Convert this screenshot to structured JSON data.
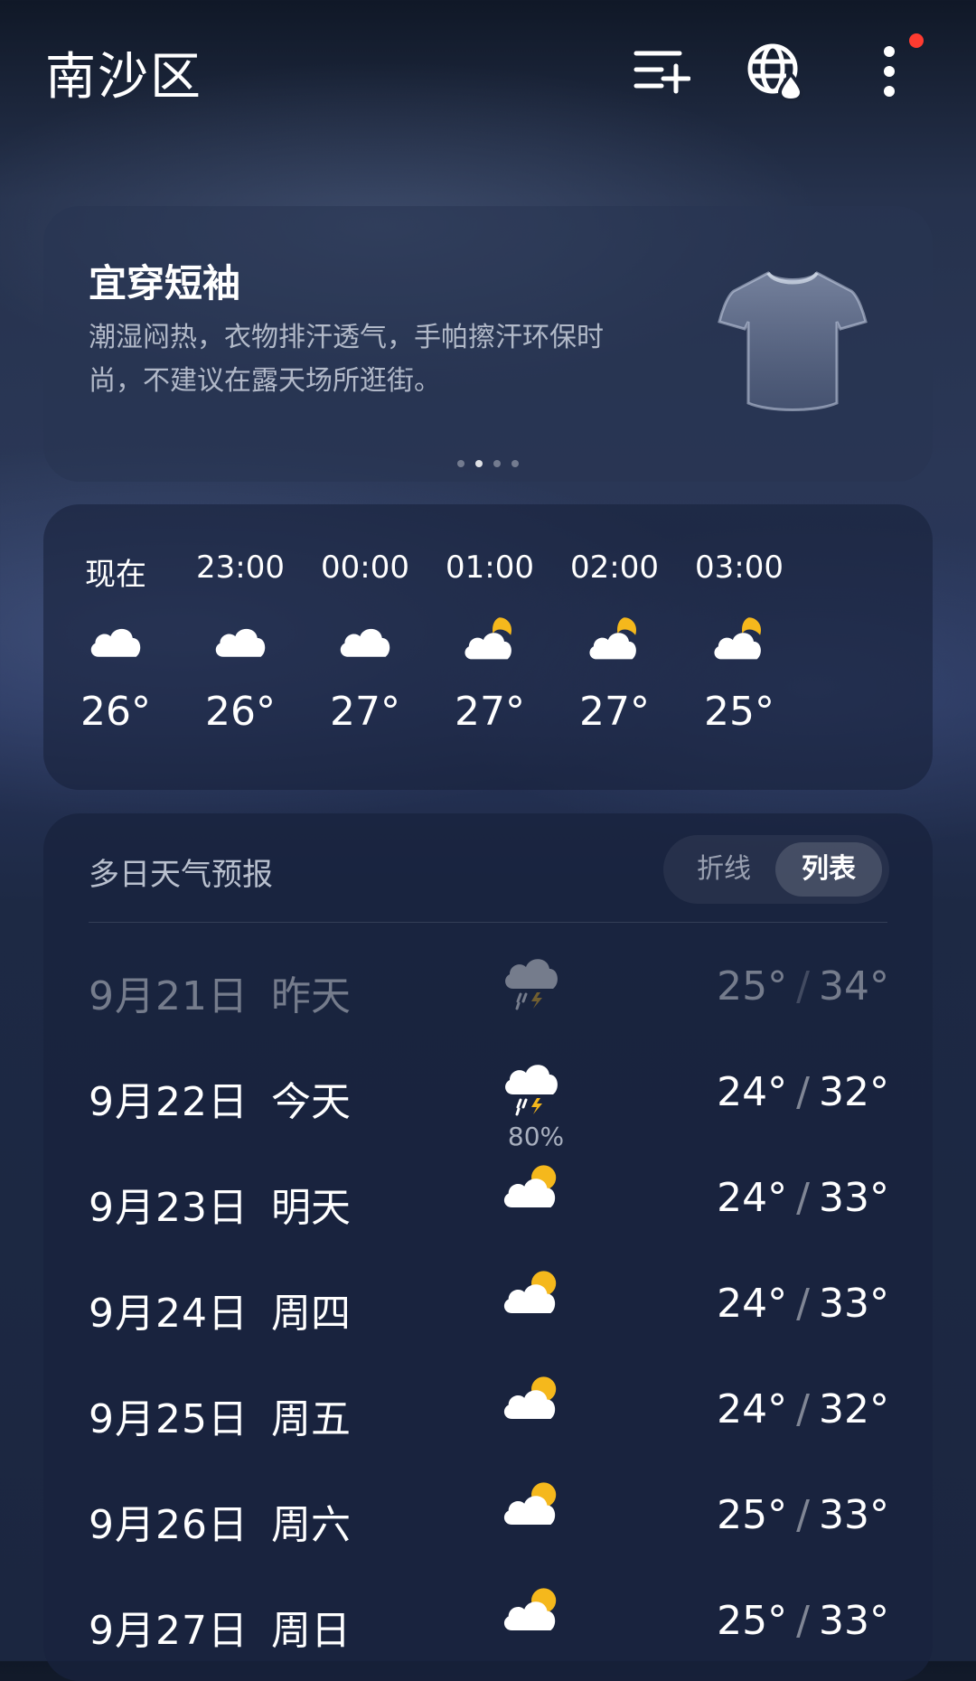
{
  "header": {
    "city": "南沙区"
  },
  "tip": {
    "title": "宜穿短袖",
    "text": "潮湿闷热，衣物排汗透气，手帕擦汗环保时尚，不建议在露天场所逛街。",
    "icon": "tshirt-icon"
  },
  "hourly": [
    {
      "time": "现在",
      "icon": "cloudy-icon",
      "temp": "26°"
    },
    {
      "time": "23:00",
      "icon": "cloudy-icon",
      "temp": "26°"
    },
    {
      "time": "00:00",
      "icon": "cloudy-icon",
      "temp": "27°"
    },
    {
      "time": "01:00",
      "icon": "partly-cloudy-night-icon",
      "temp": "27°"
    },
    {
      "time": "02:00",
      "icon": "partly-cloudy-night-icon",
      "temp": "27°"
    },
    {
      "time": "03:00",
      "icon": "partly-cloudy-night-icon",
      "temp": "25°"
    }
  ],
  "forecast": {
    "title": "多日天气预报",
    "toggle_line": "折线",
    "toggle_list": "列表",
    "days": [
      {
        "date": "9月21日",
        "day": "昨天",
        "icon": "thunderstorm-icon",
        "pop": "",
        "low": "25°",
        "high": "34°"
      },
      {
        "date": "9月22日",
        "day": "今天",
        "icon": "thunderstorm-icon",
        "pop": "80%",
        "low": "24°",
        "high": "32°"
      },
      {
        "date": "9月23日",
        "day": "明天",
        "icon": "partly-cloudy-day-icon",
        "pop": "",
        "low": "24°",
        "high": "33°"
      },
      {
        "date": "9月24日",
        "day": "周四",
        "icon": "partly-cloudy-day-icon",
        "pop": "",
        "low": "24°",
        "high": "33°"
      },
      {
        "date": "9月25日",
        "day": "周五",
        "icon": "partly-cloudy-day-icon",
        "pop": "",
        "low": "24°",
        "high": "32°"
      },
      {
        "date": "9月26日",
        "day": "周六",
        "icon": "partly-cloudy-day-icon",
        "pop": "",
        "low": "25°",
        "high": "33°"
      },
      {
        "date": "9月27日",
        "day": "周日",
        "icon": "partly-cloudy-day-icon",
        "pop": "",
        "low": "25°",
        "high": "33°"
      }
    ]
  },
  "colors": {
    "sun": "#f5b81c",
    "alert_dot": "#ff3b30"
  }
}
